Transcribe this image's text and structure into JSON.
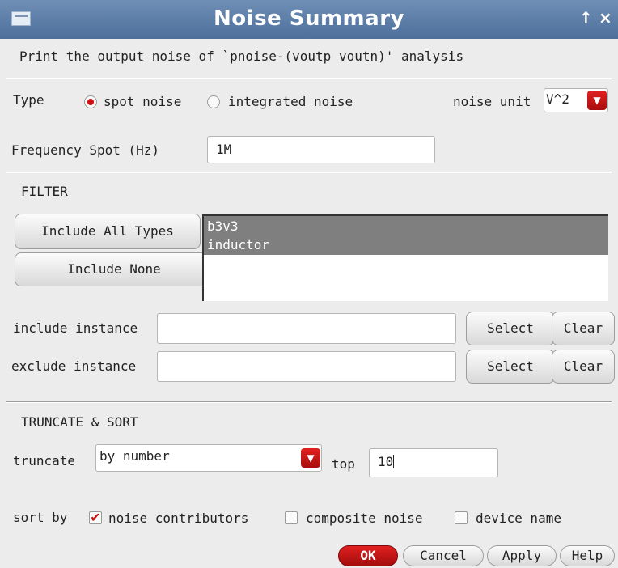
{
  "window": {
    "title": "Noise Summary",
    "buttons": {
      "up": "↑",
      "close": "×"
    }
  },
  "description": "Print the output noise of `pnoise-(voutp voutn)' analysis",
  "type_row": {
    "label": "Type",
    "options": [
      {
        "label": "spot noise",
        "selected": true
      },
      {
        "label": "integrated noise",
        "selected": false
      }
    ],
    "unit_label": "noise unit",
    "unit_value": "V^2"
  },
  "frequency": {
    "label": "Frequency Spot (Hz)",
    "value": "1M"
  },
  "filter": {
    "heading": "FILTER",
    "include_all_label": "Include All Types",
    "include_none_label": "Include None",
    "types": [
      "b3v3",
      "inductor"
    ],
    "selected_color": "#7f7f7f"
  },
  "instances": {
    "include_label": "include instance",
    "include_value": "",
    "exclude_label": "exclude instance",
    "exclude_value": "",
    "select_label": "Select",
    "clear_label": "Clear"
  },
  "truncate": {
    "heading": "TRUNCATE & SORT",
    "label": "truncate",
    "mode": "by number",
    "top_label": "top",
    "top_value": "10"
  },
  "sort": {
    "label": "sort by",
    "options": [
      {
        "label": "noise contributors",
        "checked": true
      },
      {
        "label": "composite noise",
        "checked": false
      },
      {
        "label": "device name",
        "checked": false
      }
    ]
  },
  "footer": {
    "ok": "OK",
    "cancel": "Cancel",
    "apply": "Apply",
    "help": "Help"
  },
  "colors": {
    "accent_red": "#cc1111",
    "titlebar": "#5b7ca6"
  }
}
